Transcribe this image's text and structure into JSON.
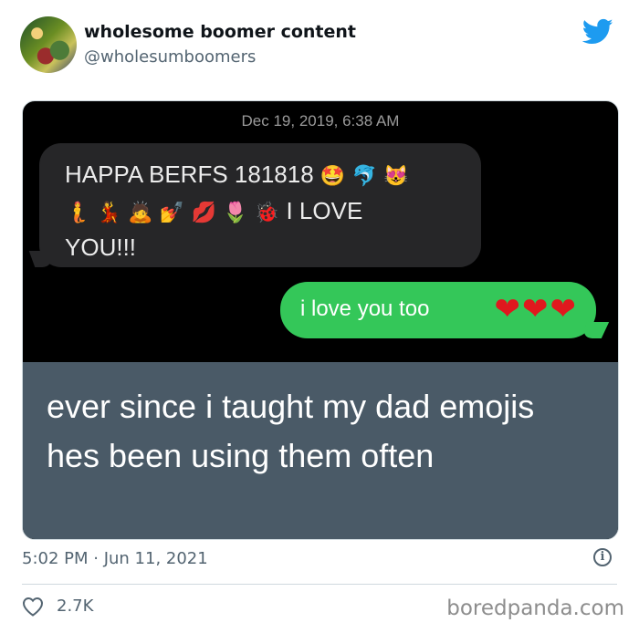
{
  "header": {
    "display_name": "wholesome boomer content",
    "handle": "@wholesumboomers",
    "avatar_icon": "profile-photo",
    "platform_icon": "twitter-bird-icon",
    "platform_color": "#1d9bf0"
  },
  "screenshot": {
    "timestamp": "Dec 19, 2019, 6:38 AM",
    "incoming_message": {
      "text_line1": "HAPPA BERFS 181818",
      "emojis_line1": [
        "🤩",
        "🐬",
        "😻"
      ],
      "emojis_line2": [
        "🧜",
        "💃",
        "🙇",
        "💅",
        "💋",
        "🌷",
        "🐞"
      ],
      "text_line2": "I LOVE",
      "text_line3": "YOU!!!"
    },
    "outgoing_message": {
      "text": "i love you too",
      "hearts": "❤❤❤"
    },
    "caption": "ever since i taught my dad emojis hes been using them often"
  },
  "footer": {
    "time": "5:02 PM · Jun 11, 2021",
    "likes": "2.7K",
    "watermark": "boredpanda.com"
  },
  "colors": {
    "incoming_bubble": "#262628",
    "outgoing_bubble": "#34c759",
    "caption_bg": "#4a5a67",
    "heart": "#e0181e"
  }
}
